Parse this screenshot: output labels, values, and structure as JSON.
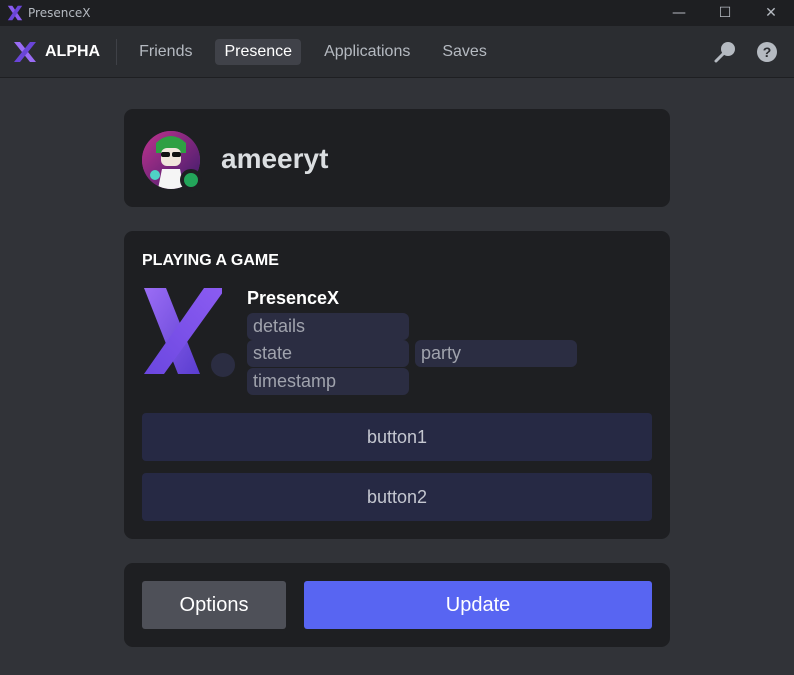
{
  "window": {
    "title": "PresenceX",
    "controls": {
      "minimize": "—",
      "maximize": "☐",
      "close": "✕"
    }
  },
  "navbar": {
    "brand": "ALPHA",
    "tabs": [
      {
        "label": "Friends",
        "active": false
      },
      {
        "label": "Presence",
        "active": true
      },
      {
        "label": "Applications",
        "active": false
      },
      {
        "label": "Saves",
        "active": false
      }
    ],
    "icons": [
      "search-icon",
      "help-icon"
    ]
  },
  "profile": {
    "username": "ameeryt",
    "status": "online",
    "status_color": "#23a55a"
  },
  "activity": {
    "header": "PLAYING A GAME",
    "game_name": "PresenceX",
    "fields": {
      "details": "details",
      "state": "state",
      "party": "party",
      "timestamp": "timestamp"
    },
    "buttons": {
      "button1": "button1",
      "button2": "button2"
    }
  },
  "actions": {
    "options": "Options",
    "update": "Update"
  },
  "colors": {
    "accent": "#5865f2",
    "brand_purple": "#7b4ae6",
    "background": "#313338",
    "card": "#1e1f22"
  }
}
